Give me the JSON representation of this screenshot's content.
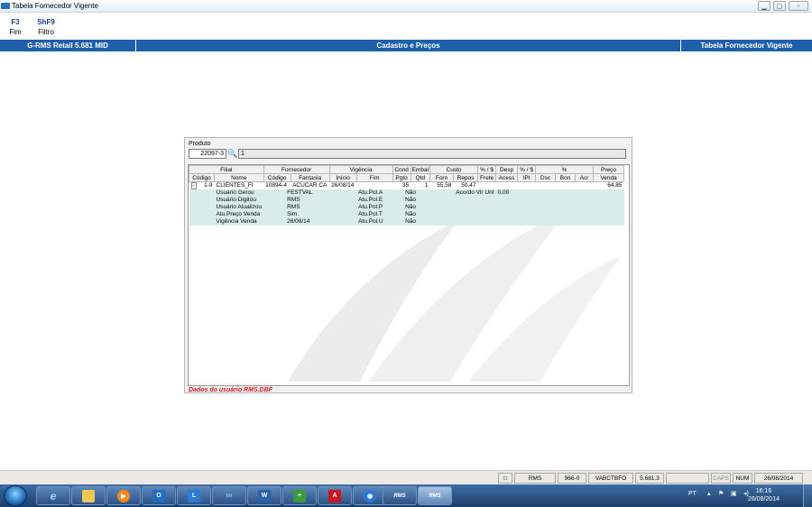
{
  "window": {
    "title": "Tabela Fornecedor Vigente",
    "icon": "app-icon"
  },
  "fkeys": [
    {
      "key": "F3",
      "label": "Fim"
    },
    {
      "key": "ShF9",
      "label": "Filtro"
    }
  ],
  "header": {
    "system": "G-RMS Retail 5.681 MID",
    "module": "Cadastro e Preços",
    "screen": "Tabela Fornecedor Vigente"
  },
  "produto": {
    "label": "Produto",
    "code": "22097-3",
    "desc": "1"
  },
  "grid": {
    "groups": [
      "Filial",
      "Fornecedor",
      "Vigência",
      "Cond",
      "Embal",
      "Custo",
      "% / $",
      "Desp",
      "% / $",
      "%",
      "Preço"
    ],
    "columns": [
      "Código",
      "Nome",
      "Código",
      "Fantasia",
      "Início",
      "Fim",
      "Pgto",
      "Qtd",
      "Forn",
      "Repos",
      "Frete",
      "Acess",
      "IPI",
      "Dsc",
      "Bon",
      "Acr",
      "Venda"
    ],
    "main_row": {
      "toggle": "−",
      "codigo": "1-9",
      "nome": "CLIENTES_FI",
      "forn_codigo": "10894-4",
      "fantasia": "ACUCAR CA",
      "inicio": "26/08/14",
      "fim": "",
      "pgto": "35",
      "qtd": "1",
      "forn": "55,58",
      "repos": "50,47",
      "venda": "64,85"
    },
    "sub_rows": [
      {
        "label": "Usuário Gerou",
        "value": "FESTVAL",
        "pol": "Atu.Pol.A",
        "flag": "Não",
        "extra_label": "Acordo Vlr Unt",
        "extra_value": "0,00"
      },
      {
        "label": "Usuário Digitou",
        "value": "RMS",
        "pol": "Atu.Pol.E",
        "flag": "Não",
        "extra_label": "",
        "extra_value": ""
      },
      {
        "label": "Usuário Atualizou",
        "value": "RMS",
        "pol": "Atu.Pol.P",
        "flag": "Não",
        "extra_label": "",
        "extra_value": ""
      },
      {
        "label": "Atu.Preço Venda",
        "value": "Sim",
        "pol": "Atu.Pol.T",
        "flag": "Não",
        "extra_label": "",
        "extra_value": ""
      },
      {
        "label": "Vigência Venda",
        "value": "26/08/14",
        "pol": "Atu.Pol.U",
        "flag": "Não",
        "extra_label": "",
        "extra_value": ""
      }
    ]
  },
  "footer_message": "Dados do usuário RMS.DBF",
  "statusbar": {
    "user": "RMS",
    "code": "966-0",
    "program": "VABCTBFO",
    "version": "5.681.3",
    "caps": "CAPS",
    "num": "NUM",
    "date": "26/08/2014"
  },
  "taskbar": {
    "apps": [
      "ie-icon",
      "explorer-icon",
      "media-icon",
      "outlook-icon",
      "lync-icon",
      "link-icon",
      "word-icon",
      "install-icon",
      "acrobat-icon",
      "remote-icon",
      "rms-icon",
      "rms-icon"
    ],
    "tray_lang": "PT",
    "time": "16:16",
    "date": "26/08/2014"
  },
  "colors": {
    "header_blue": "#1f5ea8",
    "grid_sub_row": "#d9ecec",
    "footer_red": "#cc1a1a"
  }
}
